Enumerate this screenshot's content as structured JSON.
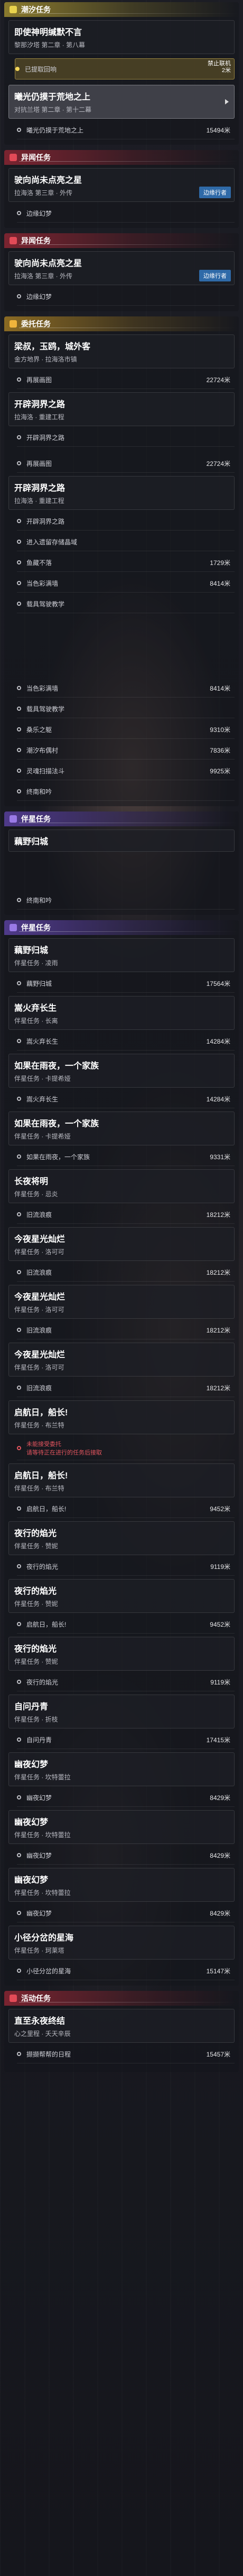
{
  "sections": [
    {
      "title": "潮汐任务",
      "quests": [
        {
          "title": "即使神明缄默不言",
          "subtitle": "黎那汐塔 第二章 · 第八幕",
          "objectives": [
            {
              "label": "已提取回响",
              "tag": "禁止联机",
              "tag2": "2米"
            }
          ]
        },
        {
          "title": "曦光仍摸于荒地之上",
          "subtitle": "对抗兰塔 第二章 · 第十二幕",
          "objectives": [
            {
              "label": "曦光仍摸于荒地之上",
              "distance": "15494米"
            }
          ]
        }
      ]
    },
    {
      "title": "异闻任务",
      "quests": [
        {
          "title": "驶向尚未点亮之星",
          "subtitle": "拉海洛 第三章 · 外传",
          "tag": "边缘行者",
          "objectives": [
            {
              "label": "边缘幻梦"
            }
          ]
        }
      ]
    },
    {
      "title": "异闻任务",
      "quests": [
        {
          "title": "驶向尚未点亮之星",
          "subtitle": "拉海洛 第三章 · 外传",
          "tag": "边缘行者",
          "objectives": [
            {
              "label": "边缘幻梦"
            }
          ]
        }
      ]
    },
    {
      "title": "委托任务",
      "quests": [
        {
          "title": "梁叔，玉鸥，城外客",
          "subtitle": "金方地界 · 拉海洛市镇",
          "objectives": [
            {
              "label": "再展画图",
              "distance": "22724米"
            }
          ]
        },
        {
          "title": "开辟洞界之路",
          "subtitle": "拉海洛 · 重建工程",
          "objectives": [
            {
              "label": "开辟洞界之路"
            },
            {
              "label": "再展画图",
              "distance": "22724米"
            }
          ]
        },
        {
          "title": "开辟洞界之路",
          "subtitle": "拉海洛 · 重建工程",
          "objectives": [
            {
              "label": "开辟洞界之路"
            },
            {
              "label": "进入遗留存储晶域"
            },
            {
              "label": "鱼藏不落",
              "distance": "1729米"
            },
            {
              "label": "当色彩满墙",
              "distance": "8414米"
            },
            {
              "label": "载具驾驶教学"
            },
            {
              "label": "当色彩满墙",
              "distance": "8414米"
            },
            {
              "label": "载具驾驶教学"
            },
            {
              "label": "桑乐之躯",
              "distance": "9310米"
            },
            {
              "label": "潮汐布偶村",
              "distance": "7836米"
            },
            {
              "label": "灵魂扫描法斗",
              "distance": "9925米"
            },
            {
              "label": "终南和吟"
            }
          ]
        }
      ]
    },
    {
      "title": "伴星任务",
      "quests": [
        {
          "title": "藕野归城",
          "objectives": [
            {
              "label": "终南和吟"
            }
          ]
        }
      ]
    },
    {
      "title": "伴星任务",
      "quests": [
        {
          "title": "藕野归城",
          "subtitle": "伴星任务 · 凌雨",
          "objectives": [
            {
              "label": "藕野归城",
              "distance": "17564米"
            }
          ]
        },
        {
          "title": "嵩火弃长生",
          "subtitle": "伴星任务 · 长离",
          "objectives": [
            {
              "label": "嵩火弃长生",
              "distance": "14284米"
            }
          ]
        },
        {
          "title": "如果在雨夜，一个家族",
          "subtitle": "伴星任务 · 卡提希娅",
          "objectives": [
            {
              "label": "嵩火弃长生",
              "distance": "14284米"
            }
          ]
        },
        {
          "title": "如果在雨夜，一个家族",
          "subtitle": "伴星任务 · 卡提希娅",
          "objectives": [
            {
              "label": "如果在雨夜，一个家族",
              "distance": "9331米"
            }
          ]
        },
        {
          "title": "长夜将明",
          "subtitle": "伴星任务 · 忌炎",
          "objectives": [
            {
              "label": "旧流浪痕",
              "distance": "18212米"
            }
          ]
        },
        {
          "title": "今夜星光灿烂",
          "subtitle": "伴星任务 · 洛可可",
          "objectives": [
            {
              "label": "旧流浪痕",
              "distance": "18212米"
            }
          ]
        },
        {
          "title": "今夜星光灿烂",
          "subtitle": "伴星任务 · 洛可可",
          "objectives": [
            {
              "label": "旧流浪痕",
              "distance": "18212米"
            }
          ]
        },
        {
          "title": "今夜星光灿烂",
          "subtitle": "伴星任务 · 洛可可",
          "objectives": [
            {
              "label": "旧流浪痕",
              "distance": "18212米"
            }
          ]
        },
        {
          "title": "启航日，船长!",
          "subtitle": "伴星任务 · 布兰特",
          "objectives": [
            {
              "label": "未能接受委托",
              "warning": "请等待正在进行的任务后接取"
            }
          ]
        },
        {
          "title": "启航日，船长!",
          "subtitle": "伴星任务 · 布兰特",
          "objectives": [
            {
              "label": "启航日，船长!",
              "distance": "9452米"
            }
          ]
        },
        {
          "title": "夜行的焰光",
          "subtitle": "伴星任务 · 赞妮",
          "objectives": [
            {
              "label": "夜行的焰光",
              "distance": "9119米"
            }
          ]
        },
        {
          "title": "夜行的焰光",
          "subtitle": "伴星任务 · 赞妮",
          "objectives": [
            {
              "label": "启航日，船长!",
              "distance": "9452米"
            }
          ]
        },
        {
          "title": "夜行的焰光",
          "subtitle": "伴星任务 · 赞妮",
          "objectives": [
            {
              "label": "夜行的焰光",
              "distance": "9119米"
            }
          ]
        },
        {
          "title": "自问丹青",
          "subtitle": "伴星任务 · 折枝",
          "objectives": [
            {
              "label": "自问丹青",
              "distance": "17415米"
            }
          ]
        },
        {
          "title": "幽夜幻梦",
          "subtitle": "伴星任务 · 坎特蕾拉",
          "objectives": [
            {
              "label": "幽夜幻梦",
              "distance": "8429米"
            }
          ]
        },
        {
          "title": "幽夜幻梦",
          "subtitle": "伴星任务 · 坎特蕾拉",
          "objectives": [
            {
              "label": "幽夜幻梦",
              "distance": "8429米"
            }
          ]
        },
        {
          "title": "幽夜幻梦",
          "subtitle": "伴星任务 · 坎特蕾拉",
          "objectives": [
            {
              "label": "幽夜幻梦",
              "distance": "8429米"
            }
          ]
        },
        {
          "title": "小径分岔的星海",
          "subtitle": "伴星任务 · 珂莱塔",
          "objectives": [
            {
              "label": "小径分岔的星海",
              "distance": "15147米"
            }
          ]
        }
      ]
    },
    {
      "title": "活动任务",
      "quests": [
        {
          "title": "直至永夜终结",
          "subtitle": "心之里程 · 夭天辛辰",
          "objectives": [
            {
              "label": "撷撷帮帮的日程",
              "distance": "15457米"
            }
          ]
        }
      ]
    }
  ]
}
